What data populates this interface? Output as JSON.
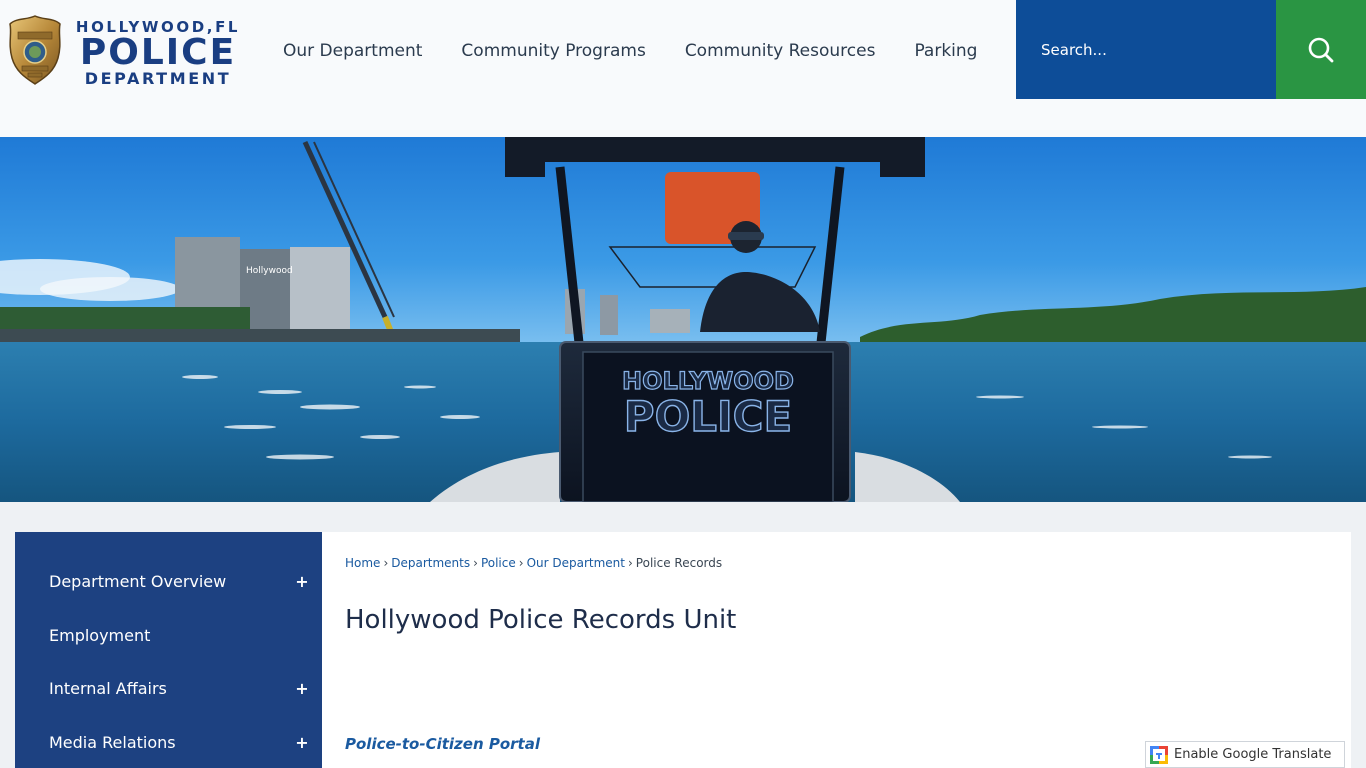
{
  "colors": {
    "brand_blue": "#1a3e82",
    "search_blue": "#0d4d98",
    "search_button_green": "#2a9543",
    "sidebar_bg": "#1d4181",
    "link_blue": "#1a5aa0"
  },
  "logo": {
    "line1": "HOLLYWOOD,FL",
    "line2": "POLICE",
    "line3": "DEPARTMENT"
  },
  "nav": {
    "items": [
      {
        "label": "Our Department"
      },
      {
        "label": "Community Programs"
      },
      {
        "label": "Community Resources"
      },
      {
        "label": "Parking"
      }
    ]
  },
  "search": {
    "placeholder": "Search...",
    "button_icon": "search-icon"
  },
  "banner": {
    "boat_text_line1": "HOLLYWOOD",
    "boat_text_line2": "POLICE",
    "building_sign": "Hollywood"
  },
  "sidebar": {
    "items": [
      {
        "label": "Department Overview",
        "expandable": true
      },
      {
        "label": "Employment",
        "expandable": false
      },
      {
        "label": "Internal Affairs",
        "expandable": true
      },
      {
        "label": "Media Relations",
        "expandable": true
      }
    ]
  },
  "breadcrumb": {
    "items": [
      "Home",
      "Departments",
      "Police",
      "Our Department"
    ],
    "current": "Police Records",
    "separator": "›"
  },
  "main": {
    "title": "Hollywood Police Records Unit",
    "portal_link": "Police-to-Citizen Portal"
  },
  "translate": {
    "label": "Enable Google Translate",
    "icon": "google-translate-icon"
  }
}
